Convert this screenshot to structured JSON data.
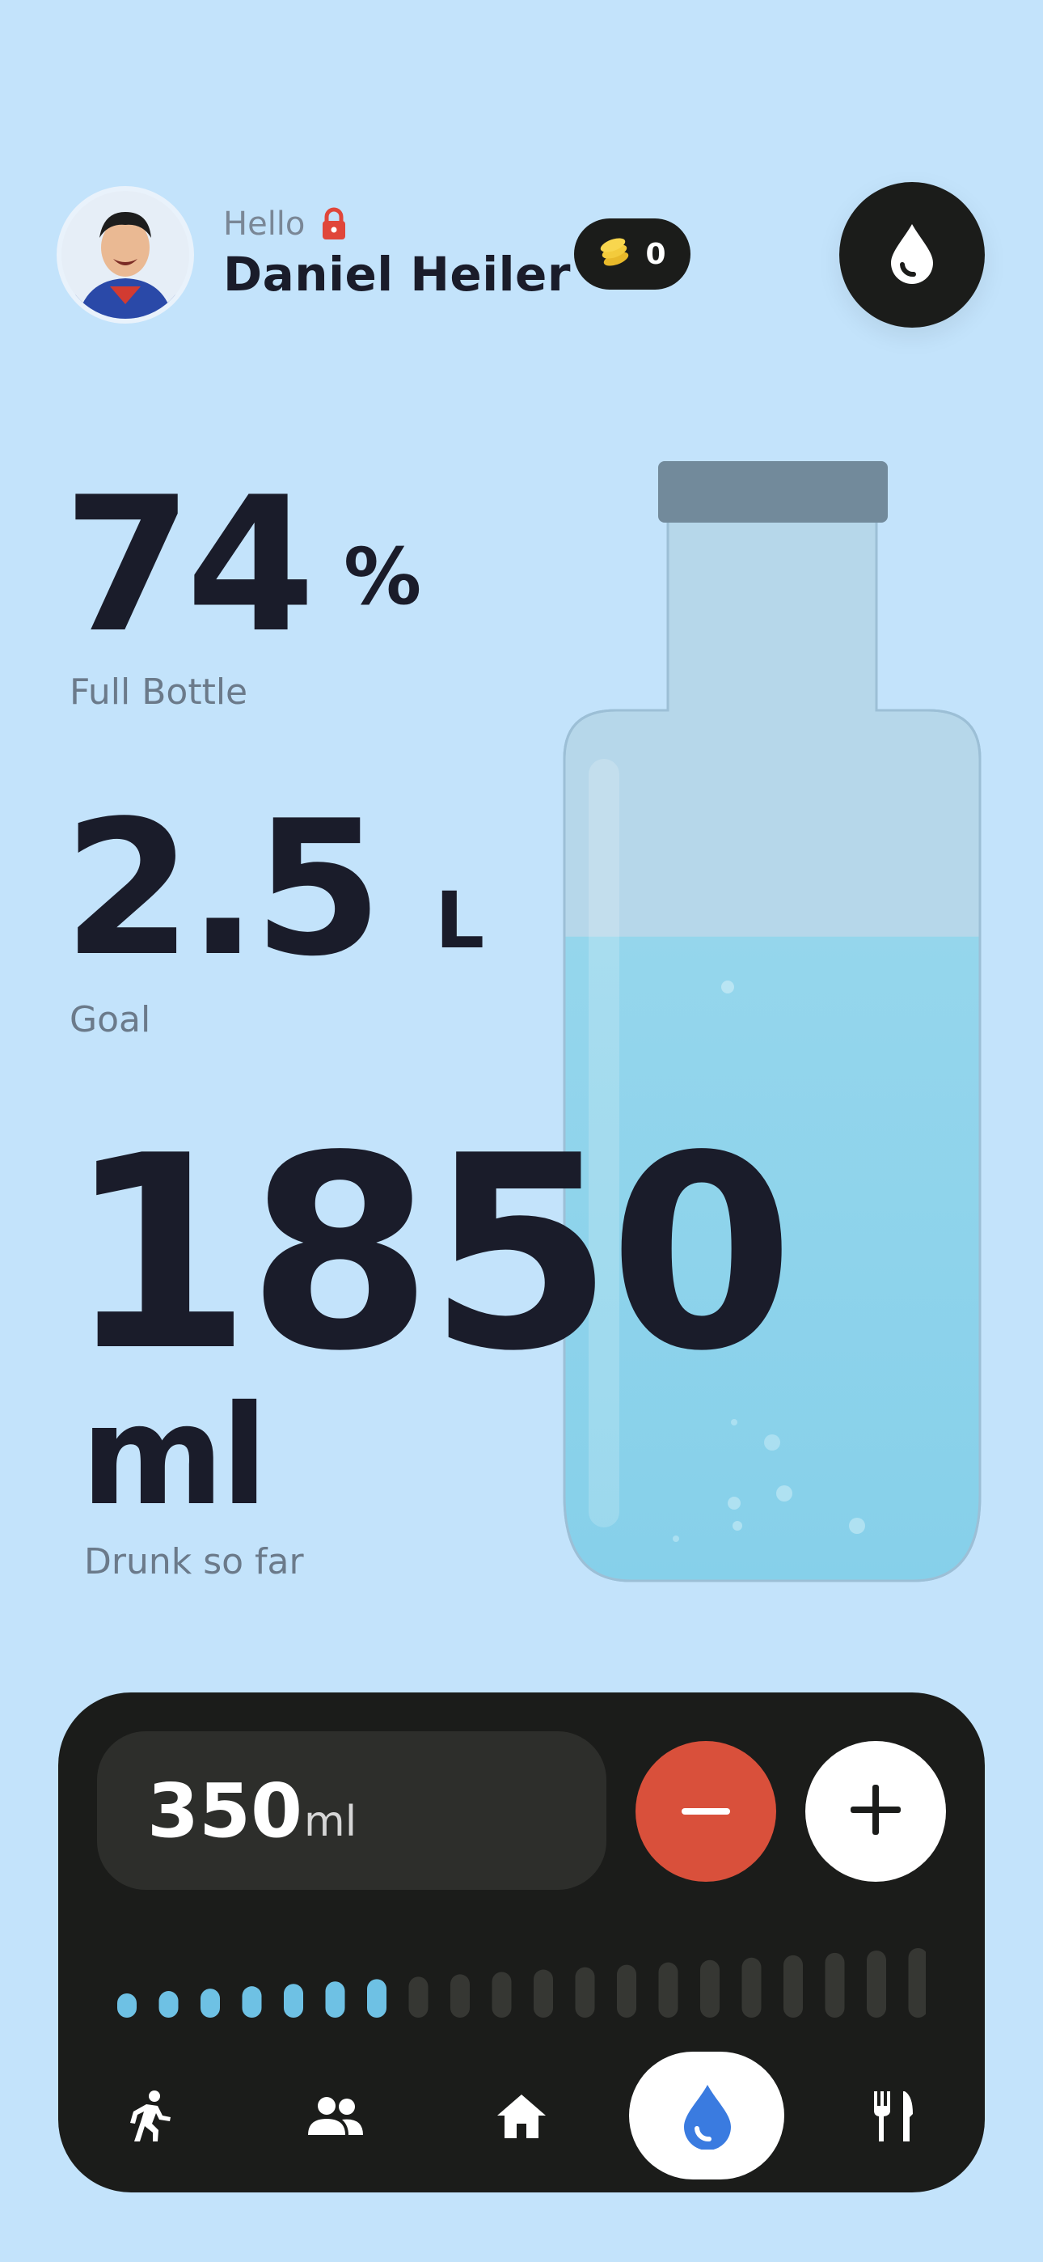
{
  "header": {
    "greeting": "Hello",
    "user_name": "Daniel Heiler",
    "coins": "0",
    "lock_icon": "lock-icon",
    "coins_icon": "coins-icon",
    "action_icon": "water-drop-icon"
  },
  "stats": {
    "percent": {
      "value": "74",
      "unit": "%",
      "label": "Full Bottle"
    },
    "goal": {
      "value": "2.5",
      "unit": "L",
      "label": "Goal"
    },
    "drunk": {
      "value": "1850",
      "unit": "ml",
      "label": "Drunk so far"
    }
  },
  "bottle": {
    "fill_level": 0.74,
    "water_color": "#8fd3ea"
  },
  "controls": {
    "amount_value": "350",
    "amount_unit": "ml",
    "minus_icon": "minus-icon",
    "plus_icon": "plus-icon",
    "level": {
      "filled": 7,
      "total": 20
    }
  },
  "nav": {
    "items": [
      {
        "icon": "running-icon",
        "active": false
      },
      {
        "icon": "people-icon",
        "active": false
      },
      {
        "icon": "home-icon",
        "active": false
      },
      {
        "icon": "water-drop-icon",
        "active": true
      },
      {
        "icon": "fork-knife-icon",
        "active": false
      }
    ]
  },
  "colors": {
    "background": "#c3e3fb",
    "dark": "#1b1c1a",
    "accent_red": "#d9503b",
    "accent_blue": "#3a7be0",
    "level_active": "#6ec1e4"
  }
}
